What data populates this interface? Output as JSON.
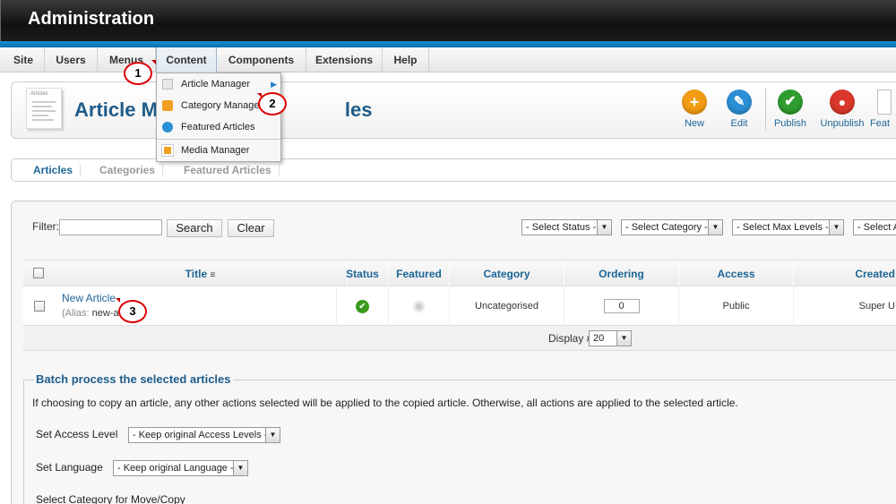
{
  "header": {
    "title": "Administration"
  },
  "menu": {
    "items": [
      "Site",
      "Users",
      "Menus",
      "Content",
      "Components",
      "Extensions",
      "Help"
    ],
    "active": "Content"
  },
  "dropdown": {
    "items": [
      "Article Manager",
      "Category Manager",
      "Featured Articles",
      "Media Manager"
    ]
  },
  "toolbar": {
    "page_title": "Article Manager: Articles",
    "page_title_visible_start": "Article M",
    "page_title_visible_end": "les",
    "page_icon_label": "Articles",
    "buttons": [
      "New",
      "Edit",
      "Publish",
      "Unpublish",
      "Feat"
    ]
  },
  "subtabs": [
    "Articles",
    "Categories",
    "Featured Articles"
  ],
  "filter": {
    "label": "Filter:",
    "value": "",
    "search_label": "Search",
    "clear_label": "Clear",
    "selects": [
      "- Select Status -",
      "- Select Category -",
      "- Select Max Levels -",
      "- Select A"
    ]
  },
  "table": {
    "headers": [
      "Title",
      "Status",
      "Featured",
      "Category",
      "Ordering",
      "Access",
      "Created"
    ],
    "rows": [
      {
        "title": "New Article",
        "alias_prefix": "(Alias: ",
        "alias": "new-a",
        "category": "Uncategorised",
        "ordering": "0",
        "access": "Public",
        "created_by": "Super U"
      }
    ],
    "display_label": "Display #",
    "display_value": "20"
  },
  "batch": {
    "legend": "Batch process the selected articles",
    "description": "If choosing to copy an article, any other actions selected will be applied to the copied article. Otherwise, all actions are applied to the selected article.",
    "access_label": "Set Access Level",
    "access_value": "- Keep original Access Levels -",
    "language_label": "Set Language",
    "language_value": "- Keep original Language -",
    "category_label": "Select Category for Move/Copy"
  },
  "callouts": [
    "1",
    "2",
    "3"
  ],
  "colors": {
    "brand_blue": "#1d6696",
    "header_dark": "#111111",
    "accent_strip": "#0a6eae",
    "callout_red": "#dd0000",
    "new_orange": "#f39c12",
    "edit_blue": "#2a8fd4",
    "publish_green": "#2e9c2e",
    "unpublish_red": "#d9382a"
  }
}
